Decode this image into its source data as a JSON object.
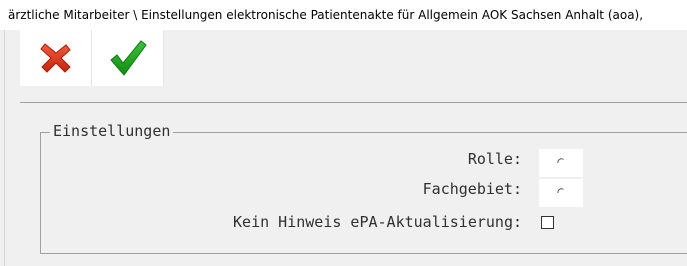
{
  "window": {
    "title": "ärztliche Mitarbeiter \\ Einstellungen elektronische Patientenakte für Allgemein AOK Sachsen Anhalt (aoa),"
  },
  "toolbar": {
    "cancel_icon": "red-x-icon",
    "confirm_icon": "green-check-icon"
  },
  "group": {
    "title": "Einstellungen",
    "fields": [
      {
        "label": "Rolle:",
        "control": "radio",
        "selected": false
      },
      {
        "label": "Fachgebiet:",
        "control": "radio",
        "selected": false
      },
      {
        "label": "Kein Hinweis ePA-Aktualisierung:",
        "control": "checkbox",
        "checked": false
      }
    ]
  },
  "colors": {
    "cancel": "#e03a1e",
    "confirm": "#1e9a1e",
    "background": "#f0f0f0"
  }
}
